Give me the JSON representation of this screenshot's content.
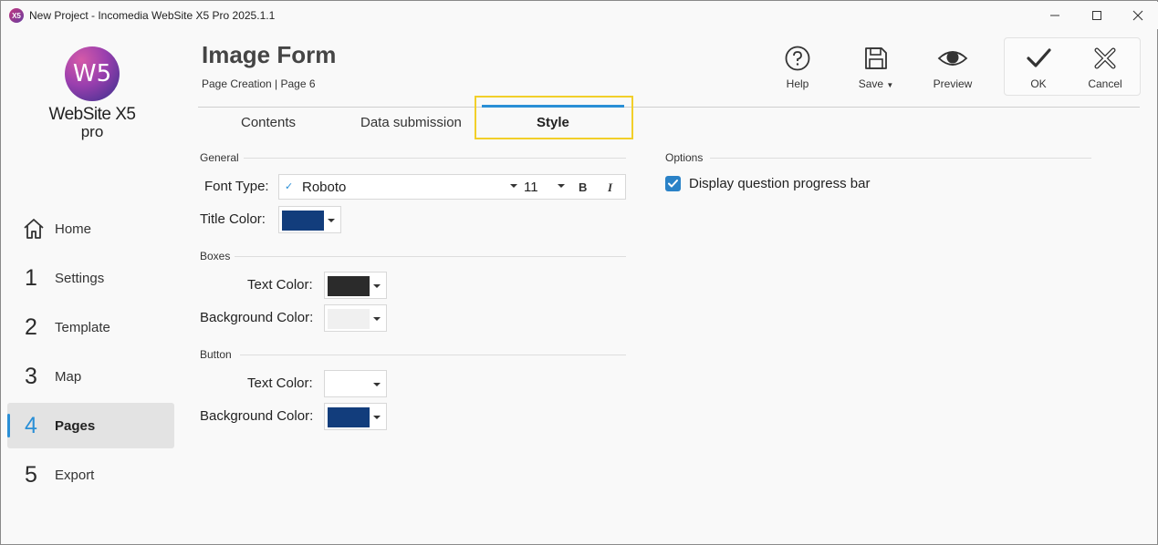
{
  "window": {
    "app_icon_text": "X5",
    "title": "New Project - Incomedia WebSite X5 Pro 2025.1.1"
  },
  "logo": {
    "mark": "W5",
    "brand": "WebSite X5",
    "edition": "pro"
  },
  "sidebar": {
    "items": [
      {
        "num": "",
        "label": "Home",
        "icon": "home-icon"
      },
      {
        "num": "1",
        "label": "Settings"
      },
      {
        "num": "2",
        "label": "Template"
      },
      {
        "num": "3",
        "label": "Map"
      },
      {
        "num": "4",
        "label": "Pages",
        "active": true
      },
      {
        "num": "5",
        "label": "Export"
      }
    ]
  },
  "header": {
    "title": "Image Form",
    "breadcrumb": "Page Creation | Page 6"
  },
  "toolbar": {
    "help": "Help",
    "save": "Save",
    "preview": "Preview",
    "ok": "OK",
    "cancel": "Cancel"
  },
  "tabs": [
    {
      "label": "Contents"
    },
    {
      "label": "Data submission"
    },
    {
      "label": "Style",
      "active": true
    }
  ],
  "general": {
    "section": "General",
    "font_type_label": "Font Type:",
    "font_name": "Roboto",
    "font_size": "11",
    "bold_label": "B",
    "italic_label": "I",
    "title_color_label": "Title Color:",
    "title_color": "#123d7c"
  },
  "boxes": {
    "section": "Boxes",
    "text_color_label": "Text Color:",
    "text_color": "#2b2b2b",
    "background_color_label": "Background Color:",
    "background_color": "#f0f0f0"
  },
  "button": {
    "section": "Button",
    "text_color_label": "Text Color:",
    "text_color": "#ffffff",
    "background_color_label": "Background Color:",
    "background_color": "#123d7c"
  },
  "options": {
    "section": "Options",
    "progress_bar_label": "Display question progress bar",
    "progress_bar_checked": true
  },
  "colors": {
    "accent": "#2a8fd6",
    "highlight": "#f2cf2a"
  }
}
